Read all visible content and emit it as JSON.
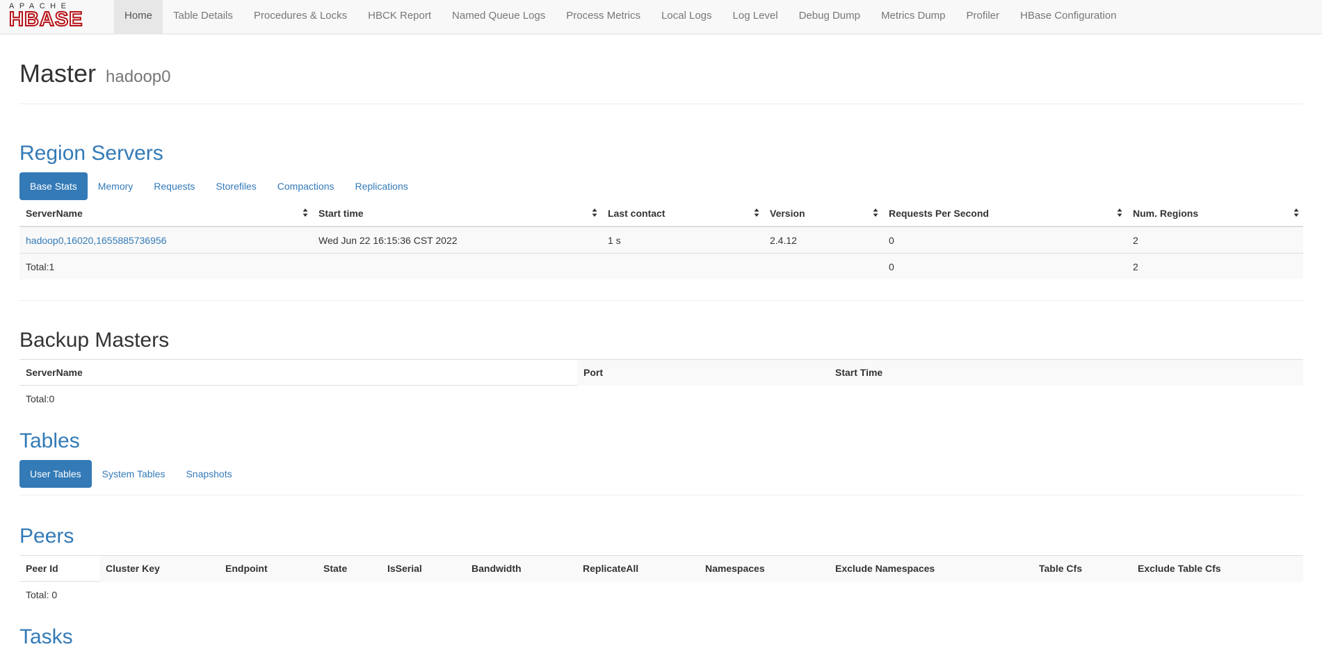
{
  "logo": {
    "top": "APACHE",
    "bottom": "HBASE"
  },
  "nav": [
    {
      "label": "Home",
      "active": true
    },
    {
      "label": "Table Details"
    },
    {
      "label": "Procedures & Locks"
    },
    {
      "label": "HBCK Report"
    },
    {
      "label": "Named Queue Logs"
    },
    {
      "label": "Process Metrics"
    },
    {
      "label": "Local Logs"
    },
    {
      "label": "Log Level"
    },
    {
      "label": "Debug Dump"
    },
    {
      "label": "Metrics Dump"
    },
    {
      "label": "Profiler"
    },
    {
      "label": "HBase Configuration"
    }
  ],
  "header": {
    "title": "Master",
    "host": "hadoop0"
  },
  "region_servers": {
    "title": "Region Servers",
    "tabs": [
      "Base Stats",
      "Memory",
      "Requests",
      "Storefiles",
      "Compactions",
      "Replications"
    ],
    "columns": [
      "ServerName",
      "Start time",
      "Last contact",
      "Version",
      "Requests Per Second",
      "Num. Regions"
    ],
    "rows": [
      [
        "hadoop0,16020,1655885736956",
        "Wed Jun 22 16:15:36 CST 2022",
        "1 s",
        "2.4.12",
        "0",
        "2"
      ]
    ],
    "total": [
      "Total:1",
      "",
      "",
      "",
      "0",
      "2"
    ]
  },
  "backup_masters": {
    "title": "Backup Masters",
    "columns": [
      "ServerName",
      "Port",
      "Start Time"
    ],
    "total": "Total:0"
  },
  "tables": {
    "title": "Tables",
    "tabs": [
      "User Tables",
      "System Tables",
      "Snapshots"
    ]
  },
  "peers": {
    "title": "Peers",
    "columns": [
      "Peer Id",
      "Cluster Key",
      "Endpoint",
      "State",
      "IsSerial",
      "Bandwidth",
      "ReplicateAll",
      "Namespaces",
      "Exclude Namespaces",
      "Table Cfs",
      "Exclude Table Cfs"
    ],
    "total": "Total: 0"
  },
  "tasks": {
    "title": "Tasks"
  },
  "colors": {
    "link": "#337ab7",
    "logo_red": "#b51116",
    "nav_active_bg": "#e7e7e7"
  }
}
